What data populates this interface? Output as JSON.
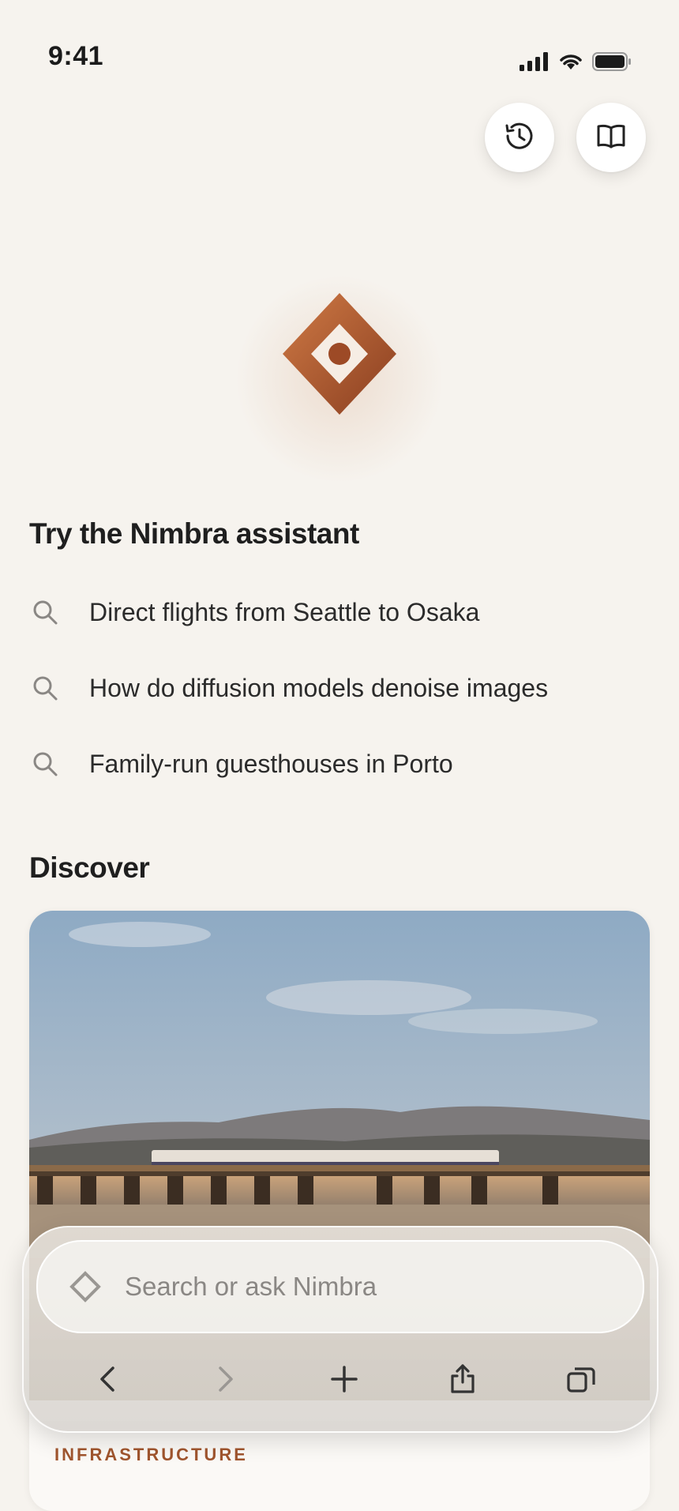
{
  "status_bar": {
    "time": "9:41"
  },
  "assistant": {
    "title": "Try the Nimbra assistant",
    "suggestions": [
      {
        "text": "Direct flights from Seattle to Osaka",
        "icon": "search-icon"
      },
      {
        "text": "How do diffusion models denoise images",
        "icon": "search-icon"
      },
      {
        "text": "Family-run guesthouses in Porto",
        "icon": "search-icon"
      }
    ]
  },
  "discover": {
    "title": "Discover",
    "card": {
      "category": "INFRASTRUCTURE",
      "image": "train-on-bridge-photo"
    }
  },
  "search": {
    "placeholder": "Search or ask Nimbra"
  },
  "toolbar": {
    "buttons": [
      "back-icon",
      "forward-icon",
      "plus-icon",
      "share-icon",
      "tabs-icon"
    ]
  },
  "top_buttons": [
    "history-icon",
    "book-icon"
  ],
  "colors": {
    "accent": "#a0552e",
    "background": "#f6f3ee",
    "logo_dark": "#8a3e20",
    "logo_light": "#c9743f"
  }
}
